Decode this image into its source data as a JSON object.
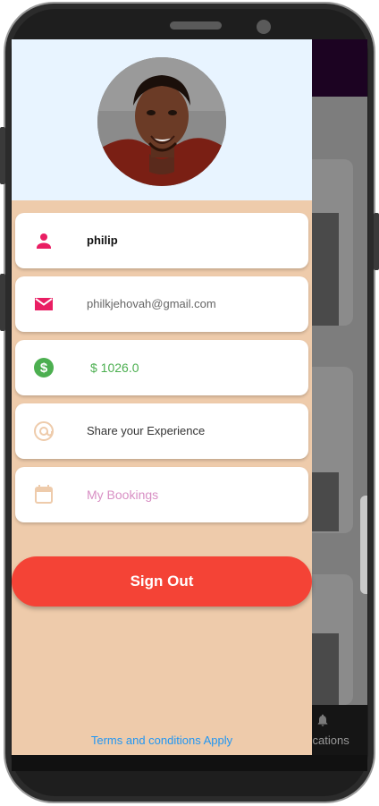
{
  "user": {
    "name": "philip",
    "email": "philkjehovah@gmail.com",
    "balance": "$ 1026.0"
  },
  "menu": {
    "share_label": "Share your Experience",
    "bookings_label": "My Bookings"
  },
  "actions": {
    "sign_out_label": "Sign Out"
  },
  "footer": {
    "terms_label": "Terms and conditions Apply"
  },
  "background": {
    "bottom_nav_label": "fications"
  },
  "icons": {
    "name": "person-icon",
    "email": "mail-icon",
    "balance": "dollar-icon",
    "share": "at-icon",
    "bookings": "calendar-icon",
    "notifications": "bell-icon"
  },
  "colors": {
    "drawer_bg": "#eecbab",
    "header_bg": "#e8f4ff",
    "accent_pink": "#e91e63",
    "balance_green": "#4caf50",
    "muted_peach": "#eecbab",
    "bookings_text": "#d88fc4",
    "signout_red": "#f44336",
    "terms_blue": "#2196f3"
  }
}
